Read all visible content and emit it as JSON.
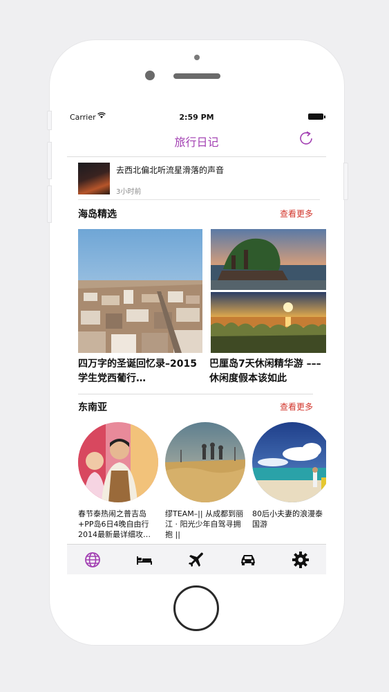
{
  "status_bar": {
    "carrier": "Carrier",
    "time": "2:59 PM"
  },
  "nav": {
    "title": "旅行日记"
  },
  "news": {
    "title": "去西北偏北听流星滑落的声音",
    "time": "3小时前"
  },
  "island_section": {
    "title": "海岛精选",
    "more": "查看更多",
    "cards": [
      {
        "caption": "四万字的圣诞回忆录–2015学生党西葡行…"
      },
      {
        "caption": "巴厘岛7天休闲精华游 ––– 休闲度假本该如此"
      }
    ]
  },
  "sea_section": {
    "title": "东南亚",
    "more": "查看更多",
    "items": [
      {
        "caption": "春节泰热闹之普吉岛+PP岛6日4晚自由行2014最新最详细攻…"
      },
      {
        "caption": "缪TEAM–|| 从成都到丽江 · 阳光少年自驾寻拥抱 ||"
      },
      {
        "caption": "80后小夫妻的浪漫泰国游"
      }
    ]
  },
  "tabs": [
    "globe-icon",
    "bed-icon",
    "airplane-icon",
    "car-icon",
    "gear-icon"
  ],
  "colors": {
    "accent": "#a23fb2",
    "more_link": "#d2352b",
    "tab_inactive": "#111111"
  }
}
